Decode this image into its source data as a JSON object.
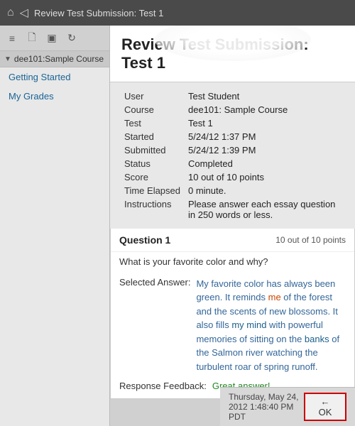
{
  "topbar": {
    "title": "Review Test Submission: Test 1",
    "home_icon": "⌂",
    "back_icon": "◁"
  },
  "sidebar": {
    "course_label": "dee101:Sample Course",
    "arrow": "▼",
    "nav_items": [
      {
        "label": "Getting Started",
        "id": "getting-started"
      },
      {
        "label": "My Grades",
        "id": "my-grades"
      }
    ],
    "toolbar_icons": [
      "≡",
      "📄",
      "▣",
      "↻"
    ]
  },
  "page_heading": "Review Test Submission: Test 1",
  "info_rows": [
    {
      "label": "User",
      "value": "Test Student"
    },
    {
      "label": "Course",
      "value": "dee101: Sample Course"
    },
    {
      "label": "Test",
      "value": "Test 1"
    },
    {
      "label": "Started",
      "value": "5/24/12 1:37 PM"
    },
    {
      "label": "Submitted",
      "value": "5/24/12 1:39 PM"
    },
    {
      "label": "Status",
      "value": "Completed"
    },
    {
      "label": "Score",
      "value": "10 out of 10 points"
    },
    {
      "label": "Time Elapsed",
      "value": "0 minute."
    },
    {
      "label": "Instructions",
      "value": "Please answer each essay question in 250 words or less."
    }
  ],
  "question": {
    "title": "Question 1",
    "score": "10 out of 10 points",
    "text": "What is your favorite color and why?",
    "answer_label": "Selected Answer:",
    "answer_parts": [
      {
        "text": "My favorite color has always been green.",
        "color": "blue"
      },
      {
        "text": " It reminds ",
        "color": "blue"
      },
      {
        "text": "me",
        "color": "red"
      },
      {
        "text": " of the forest and the scents of new blossoms. It also fills ",
        "color": "blue"
      },
      {
        "text": "my mind",
        "color": "darkblue"
      },
      {
        "text": " with powerful memories of sitting on the ",
        "color": "blue"
      },
      {
        "text": "banks",
        "color": "darkblue"
      },
      {
        "text": " of the Salmon river watching the turbulent roar of spring runoff.",
        "color": "blue"
      }
    ],
    "feedback_label": "Response Feedback:",
    "feedback_text": "Great answer!"
  },
  "footer": {
    "timestamp": "Thursday, May 24, 2012 1:48:40 PM PDT",
    "ok_label": "← OK"
  }
}
